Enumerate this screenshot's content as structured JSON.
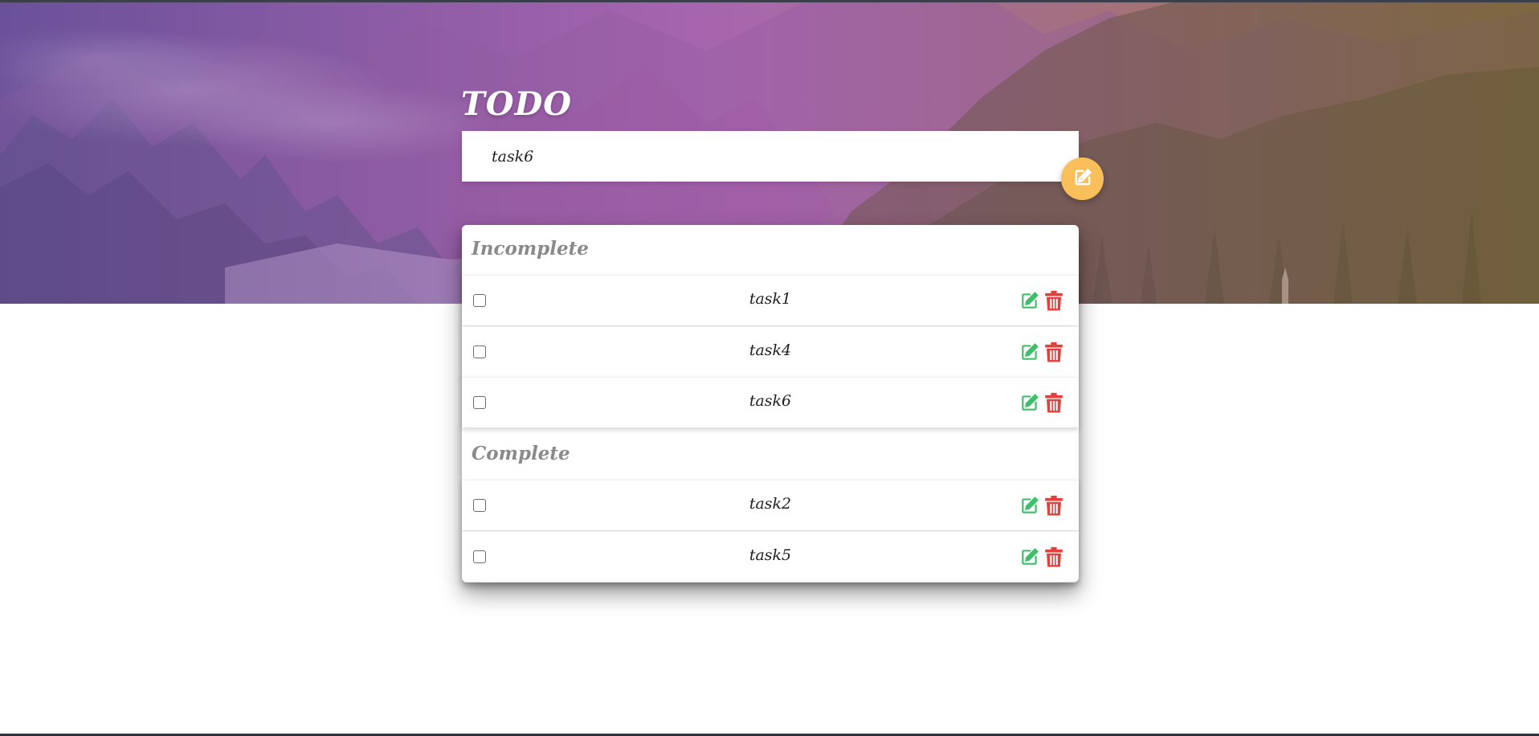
{
  "app": {
    "title": "TODO"
  },
  "input": {
    "value": "task6",
    "add_icon": "pencil-square-icon"
  },
  "incomplete": {
    "title": "Incomplete",
    "items": [
      {
        "label": "task1",
        "checked": false
      },
      {
        "label": "task4",
        "checked": false
      },
      {
        "label": "task6",
        "checked": false
      }
    ]
  },
  "complete": {
    "title": "Complete",
    "items": [
      {
        "label": "task2",
        "checked": false
      },
      {
        "label": "task5",
        "checked": false
      }
    ]
  },
  "icons": {
    "edit": "pencil-square-icon",
    "delete": "trash-icon"
  },
  "colors": {
    "edit": "#3fbf6a",
    "delete": "#e0413c",
    "add_button": "#f8bf5a",
    "section_title": "#8a8a8a"
  }
}
